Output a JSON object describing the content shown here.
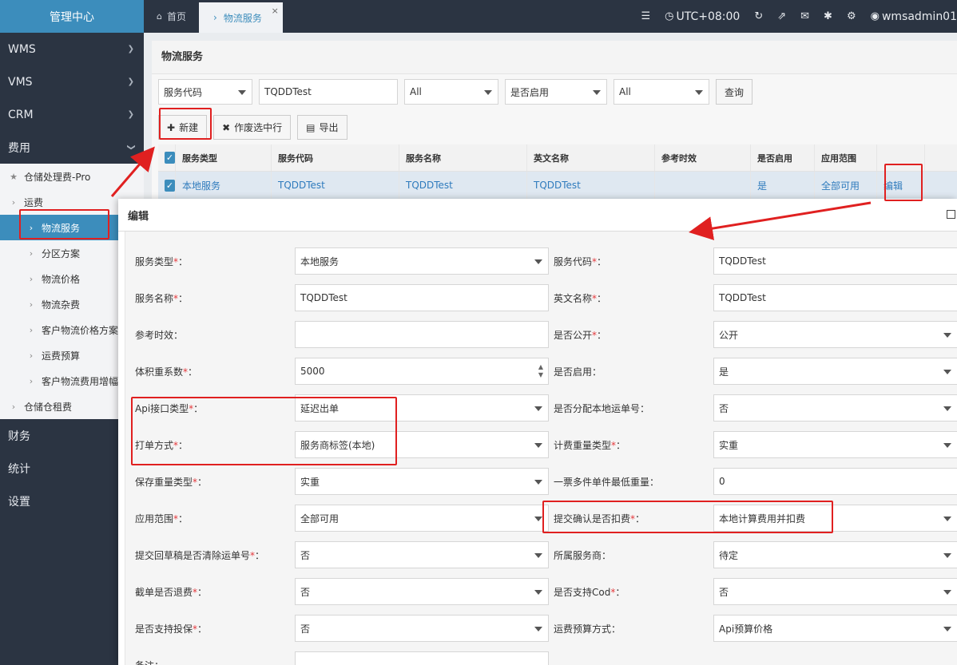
{
  "sidebar": {
    "brand": "管理中心",
    "top_items": [
      {
        "label": "WMS"
      },
      {
        "label": "VMS"
      },
      {
        "label": "CRM"
      },
      {
        "label": "费用"
      }
    ],
    "fee_children": [
      {
        "label": "仓储处理费-Pro",
        "icon": "star-icon"
      },
      {
        "label": "运费",
        "icon": "chevron-right-icon"
      },
      {
        "label": "物流服务",
        "icon": "chevron-right-icon"
      },
      {
        "label": "分区方案",
        "icon": "chevron-right-icon"
      },
      {
        "label": "物流价格",
        "icon": "chevron-right-icon"
      },
      {
        "label": "物流杂费",
        "icon": "chevron-right-icon"
      },
      {
        "label": "客户物流价格方案",
        "icon": "chevron-right-icon"
      },
      {
        "label": "运费预算",
        "icon": "chevron-right-icon"
      },
      {
        "label": "客户物流费用增幅",
        "icon": "chevron-right-icon"
      },
      {
        "label": "仓储仓租费",
        "icon": "chevron-right-icon"
      }
    ],
    "bottom_items": [
      {
        "label": "财务"
      },
      {
        "label": "统计"
      },
      {
        "label": "设置"
      }
    ]
  },
  "topbar": {
    "tabs": [
      {
        "label": "首页"
      },
      {
        "label": "物流服务"
      }
    ],
    "timezone": "UTC+08:00",
    "user": "wmsadmin01"
  },
  "page": {
    "title": "物流服务",
    "filters": {
      "field_select": "服务代码",
      "field_value": "TQDDTest",
      "type_select": "All",
      "enabled_select": "是否启用",
      "enabled_value": "All",
      "query_label": "查询"
    },
    "actions": {
      "new": "新建",
      "void": "作废选中行",
      "export": "导出"
    },
    "table": {
      "headers": [
        "服务类型",
        "服务代码",
        "服务名称",
        "英文名称",
        "参考时效",
        "是否启用",
        "应用范围"
      ],
      "rows": [
        [
          "本地服务",
          "TQDDTest",
          "TQDDTest",
          "TQDDTest",
          "",
          "是",
          "全部可用"
        ]
      ],
      "edit_label": "编辑"
    }
  },
  "modal": {
    "title": "编辑",
    "fields": [
      {
        "label": "服务类型",
        "required": "*",
        "value": "本地服务",
        "kind": "select"
      },
      {
        "label": "服务代码",
        "required": "*",
        "value": "TQDDTest",
        "kind": "text"
      },
      {
        "label": "服务名称",
        "required": "*",
        "value": "TQDDTest",
        "kind": "text"
      },
      {
        "label": "英文名称",
        "required": "*",
        "value": "TQDDTest",
        "kind": "text"
      },
      {
        "label": "参考时效",
        "required": "",
        "value": "",
        "kind": "text"
      },
      {
        "label": "是否公开",
        "required": "*",
        "value": "公开",
        "kind": "select"
      },
      {
        "label": "体积重系数",
        "required": "*",
        "value": "5000",
        "kind": "number"
      },
      {
        "label": "是否启用",
        "required": "",
        "value": "是",
        "kind": "select"
      },
      {
        "label": "Api接口类型",
        "required": "*",
        "value": "延迟出单",
        "kind": "select"
      },
      {
        "label": "是否分配本地运单号",
        "required": "",
        "value": "否",
        "kind": "select"
      },
      {
        "label": "打单方式",
        "required": "*",
        "value": "服务商标签(本地)",
        "kind": "select"
      },
      {
        "label": "计费重量类型",
        "required": "*",
        "value": "实重",
        "kind": "select"
      },
      {
        "label": "保存重量类型",
        "required": "*",
        "value": "实重",
        "kind": "select"
      },
      {
        "label": "一票多件单件最低重量",
        "required": "",
        "value": "0",
        "kind": "text"
      },
      {
        "label": "应用范围",
        "required": "*",
        "value": "全部可用",
        "kind": "select"
      },
      {
        "label": "提交确认是否扣费",
        "required": "*",
        "value": "本地计算费用并扣费",
        "kind": "select"
      },
      {
        "label": "提交回草稿是否清除运单号",
        "required": "*",
        "value": "否",
        "kind": "select"
      },
      {
        "label": "所属服务商",
        "required": "",
        "value": "待定",
        "kind": "select"
      },
      {
        "label": "截单是否退费",
        "required": "*",
        "value": "否",
        "kind": "select"
      },
      {
        "label": "是否支持Cod",
        "required": "*",
        "value": "否",
        "kind": "select"
      },
      {
        "label": "是否支持投保",
        "required": "*",
        "value": "否",
        "kind": "select"
      },
      {
        "label": "运费预算方式",
        "required": "",
        "value": "Api预算价格",
        "kind": "select"
      },
      {
        "label": "备注",
        "required": "",
        "value": "",
        "kind": "text"
      }
    ]
  },
  "colors": {
    "accent": "#3c8dbc",
    "sidebar_bg": "#2b3442",
    "annotation": "#e02020"
  }
}
